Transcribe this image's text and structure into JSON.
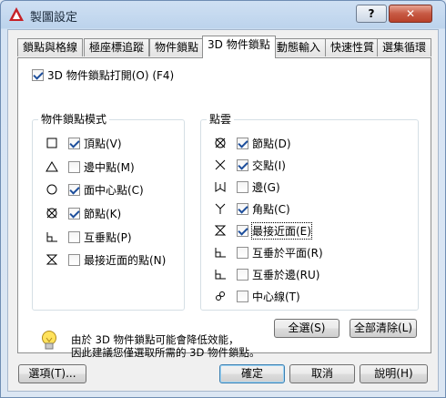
{
  "window": {
    "title": "製圖設定",
    "help": "?",
    "close": "✕"
  },
  "tabs": [
    {
      "label": "鎖點與格線"
    },
    {
      "label": "極座標追蹤"
    },
    {
      "label": "物件鎖點"
    },
    {
      "label": "3D 物件鎖點"
    },
    {
      "label": "動態輸入"
    },
    {
      "label": "快速性質"
    },
    {
      "label": "選集循環"
    }
  ],
  "master_toggle": {
    "label": "3D 物件鎖點打開(O) (F4)",
    "checked": true
  },
  "modes_group": {
    "legend": "物件鎖點模式",
    "items": [
      {
        "icon": "square-vertex-icon",
        "label": "頂點(V)",
        "checked": true
      },
      {
        "icon": "triangle-midpoint-icon",
        "label": "邊中點(M)",
        "checked": false
      },
      {
        "icon": "circle-center-icon",
        "label": "面中心點(C)",
        "checked": true
      },
      {
        "icon": "circle-x-node-icon",
        "label": "節點(K)",
        "checked": true
      },
      {
        "icon": "perpendicular-icon",
        "label": "互垂點(P)",
        "checked": false
      },
      {
        "icon": "hourglass-nearest-icon",
        "label": "最接近面的點(N)",
        "checked": false
      }
    ]
  },
  "cloud_group": {
    "legend": "點雲",
    "items": [
      {
        "icon": "circle-x-node-icon",
        "label": "節點(D)",
        "checked": true
      },
      {
        "icon": "x-intersection-icon",
        "label": "交點(I)",
        "checked": true
      },
      {
        "icon": "edge-icon",
        "label": "邊(G)",
        "checked": false
      },
      {
        "icon": "y-corner-icon",
        "label": "角點(C)",
        "checked": true
      },
      {
        "icon": "hourglass-nearest-icon",
        "label": "最接近面(E)",
        "checked": true
      },
      {
        "icon": "perpendicular-plane-icon",
        "label": "互垂於平面(R)",
        "checked": false
      },
      {
        "icon": "perpendicular-edge-icon",
        "label": "互垂於邊(RU)",
        "checked": false
      },
      {
        "icon": "centerline-icon",
        "label": "中心線(T)",
        "checked": false
      }
    ]
  },
  "buttons": {
    "select_all": "全選(S)",
    "clear_all": "全部清除(L)",
    "options": "選項(T)...",
    "ok": "確定",
    "cancel": "取消",
    "help": "說明(H)"
  },
  "info": {
    "icon": "lightbulb-icon",
    "line1": "由於 3D 物件鎖點可能會降低效能，",
    "line2": "因此建議您僅選取所需的 3D 物件鎖點。"
  }
}
